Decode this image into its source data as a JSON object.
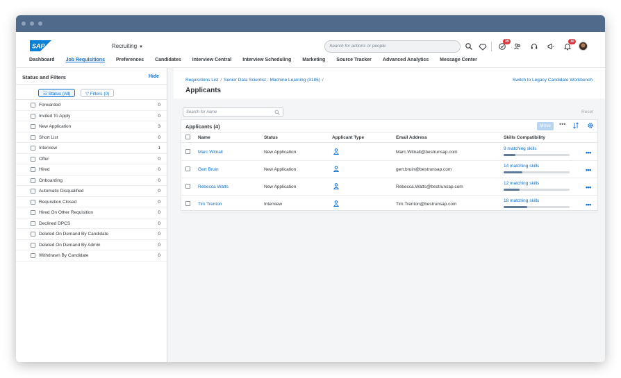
{
  "shell": {
    "logo_text": "SAP",
    "module": "Recruiting",
    "search_placeholder": "Search for actions or people",
    "notifications": {
      "tasks_badge": "39",
      "bell_badge": "10"
    },
    "nav": [
      "Dashboard",
      "Job Requisitions",
      "Preferences",
      "Candidates",
      "Interview Central",
      "Interview Scheduling",
      "Marketing",
      "Source Tracker",
      "Advanced Analytics",
      "Message Center"
    ],
    "active_nav": "Job Requisitions"
  },
  "sidebar": {
    "title": "Status and Filters",
    "hide_label": "Hide",
    "status_chip": "Status (All)",
    "filters_chip": "Filters (0)",
    "statuses": [
      {
        "label": "Forwarded",
        "count": "0"
      },
      {
        "label": "Invited To Apply",
        "count": "0"
      },
      {
        "label": "New Application",
        "count": "3"
      },
      {
        "label": "Short List",
        "count": "0"
      },
      {
        "label": "Interview",
        "count": "1"
      },
      {
        "label": "Offer",
        "count": "0"
      },
      {
        "label": "Hired",
        "count": "0"
      },
      {
        "label": "Onboarding",
        "count": "0"
      },
      {
        "label": "Automatic Disqualified",
        "count": "0"
      },
      {
        "label": "Requisition Closed",
        "count": "0"
      },
      {
        "label": "Hired On Other Requisition",
        "count": "0"
      },
      {
        "label": "Declined DPCS",
        "count": "0"
      },
      {
        "label": "Deleted On Demand By Candidate",
        "count": "0"
      },
      {
        "label": "Deleted On Demand By Admin",
        "count": "0"
      },
      {
        "label": "Withdrawn By Candidate",
        "count": "0"
      }
    ]
  },
  "main": {
    "breadcrumb": [
      "Requisitions List",
      "Senior Data Scientist - Machine Learning (3185)"
    ],
    "legacy_link": "Switch to Legacy Candidate Workbench",
    "title": "Applicants",
    "name_search_placeholder": "Search for name",
    "reset_label": "Reset",
    "table": {
      "title": "Applicants (4)",
      "move_label": "Move",
      "columns": [
        "Name",
        "Status",
        "Applicant Type",
        "Email Address",
        "Skills Compatibility"
      ],
      "rows": [
        {
          "name": "Marc Witnall",
          "status": "New Application",
          "email": "Marc.Witnall@bestrunsap.com",
          "skills": "9 matching skills",
          "skill_fraction": 0.18
        },
        {
          "name": "Gert Bruin",
          "status": "New Application",
          "email": "gert.bruin@bestrunsap.com",
          "skills": "14 matching skills",
          "skill_fraction": 0.28
        },
        {
          "name": "Rebecca Watts",
          "status": "New Application",
          "email": "Rebecca.Watts@bestrunsap.com",
          "skills": "12 matching skills",
          "skill_fraction": 0.24
        },
        {
          "name": "Tim Trenton",
          "status": "Interview",
          "email": "Tim.Trenton@bestrunsap.com",
          "skills": "18 matching skills",
          "skill_fraction": 0.36
        }
      ]
    }
  },
  "colors": {
    "accent": "#0a6ed1",
    "titlebar": "#4f6a8b",
    "badge": "#d9363e"
  },
  "icons": [
    "search-icon",
    "gem-icon",
    "tasks-icon",
    "people-icon",
    "headset-icon",
    "megaphone-icon",
    "bell-icon",
    "person-icon",
    "sort-icon",
    "gear-icon",
    "more-icon"
  ]
}
